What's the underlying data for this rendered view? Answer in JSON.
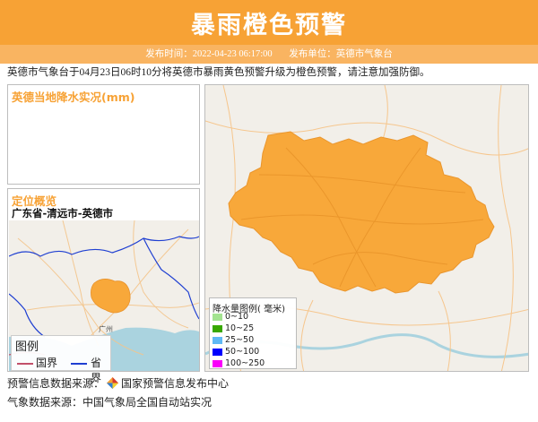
{
  "header": {
    "title": "暴雨橙色预警",
    "publish_time_label": "发布时间：",
    "publish_time": "2022-04-23 06:17:00",
    "publisher_label": "发布单位：",
    "publisher": "英德市气象台"
  },
  "intro": "英德市气象台于04月23日06时10分将英德市暴雨黄色预警升级为橙色预警，请注意加强防御。",
  "rain_panel": {
    "title": "英德当地降水实况(mm)"
  },
  "location_panel": {
    "title": "定位概览",
    "path": "广东省-清远市-英德市",
    "city_label": "广州",
    "legend": {
      "title": "图例",
      "country": "国界",
      "province": "省界"
    }
  },
  "map_panel": {
    "legend_title": "降水量图例( 毫米)",
    "legend_items": [
      {
        "label": "0~10",
        "color": "#a3e390"
      },
      {
        "label": "10~25",
        "color": "#38a800"
      },
      {
        "label": "25~50",
        "color": "#5fb9f5"
      },
      {
        "label": "50~100",
        "color": "#0000fe"
      },
      {
        "label": "100~250",
        "color": "#fa00fa"
      }
    ],
    "warning_color": "#f8a83a"
  },
  "footer": {
    "warning_source_label": "预警信息数据来源：",
    "warning_source": "国家预警信息发布中心",
    "weather_source_label": "气象数据来源：",
    "weather_source": "中国气象局全国自动站实况"
  }
}
